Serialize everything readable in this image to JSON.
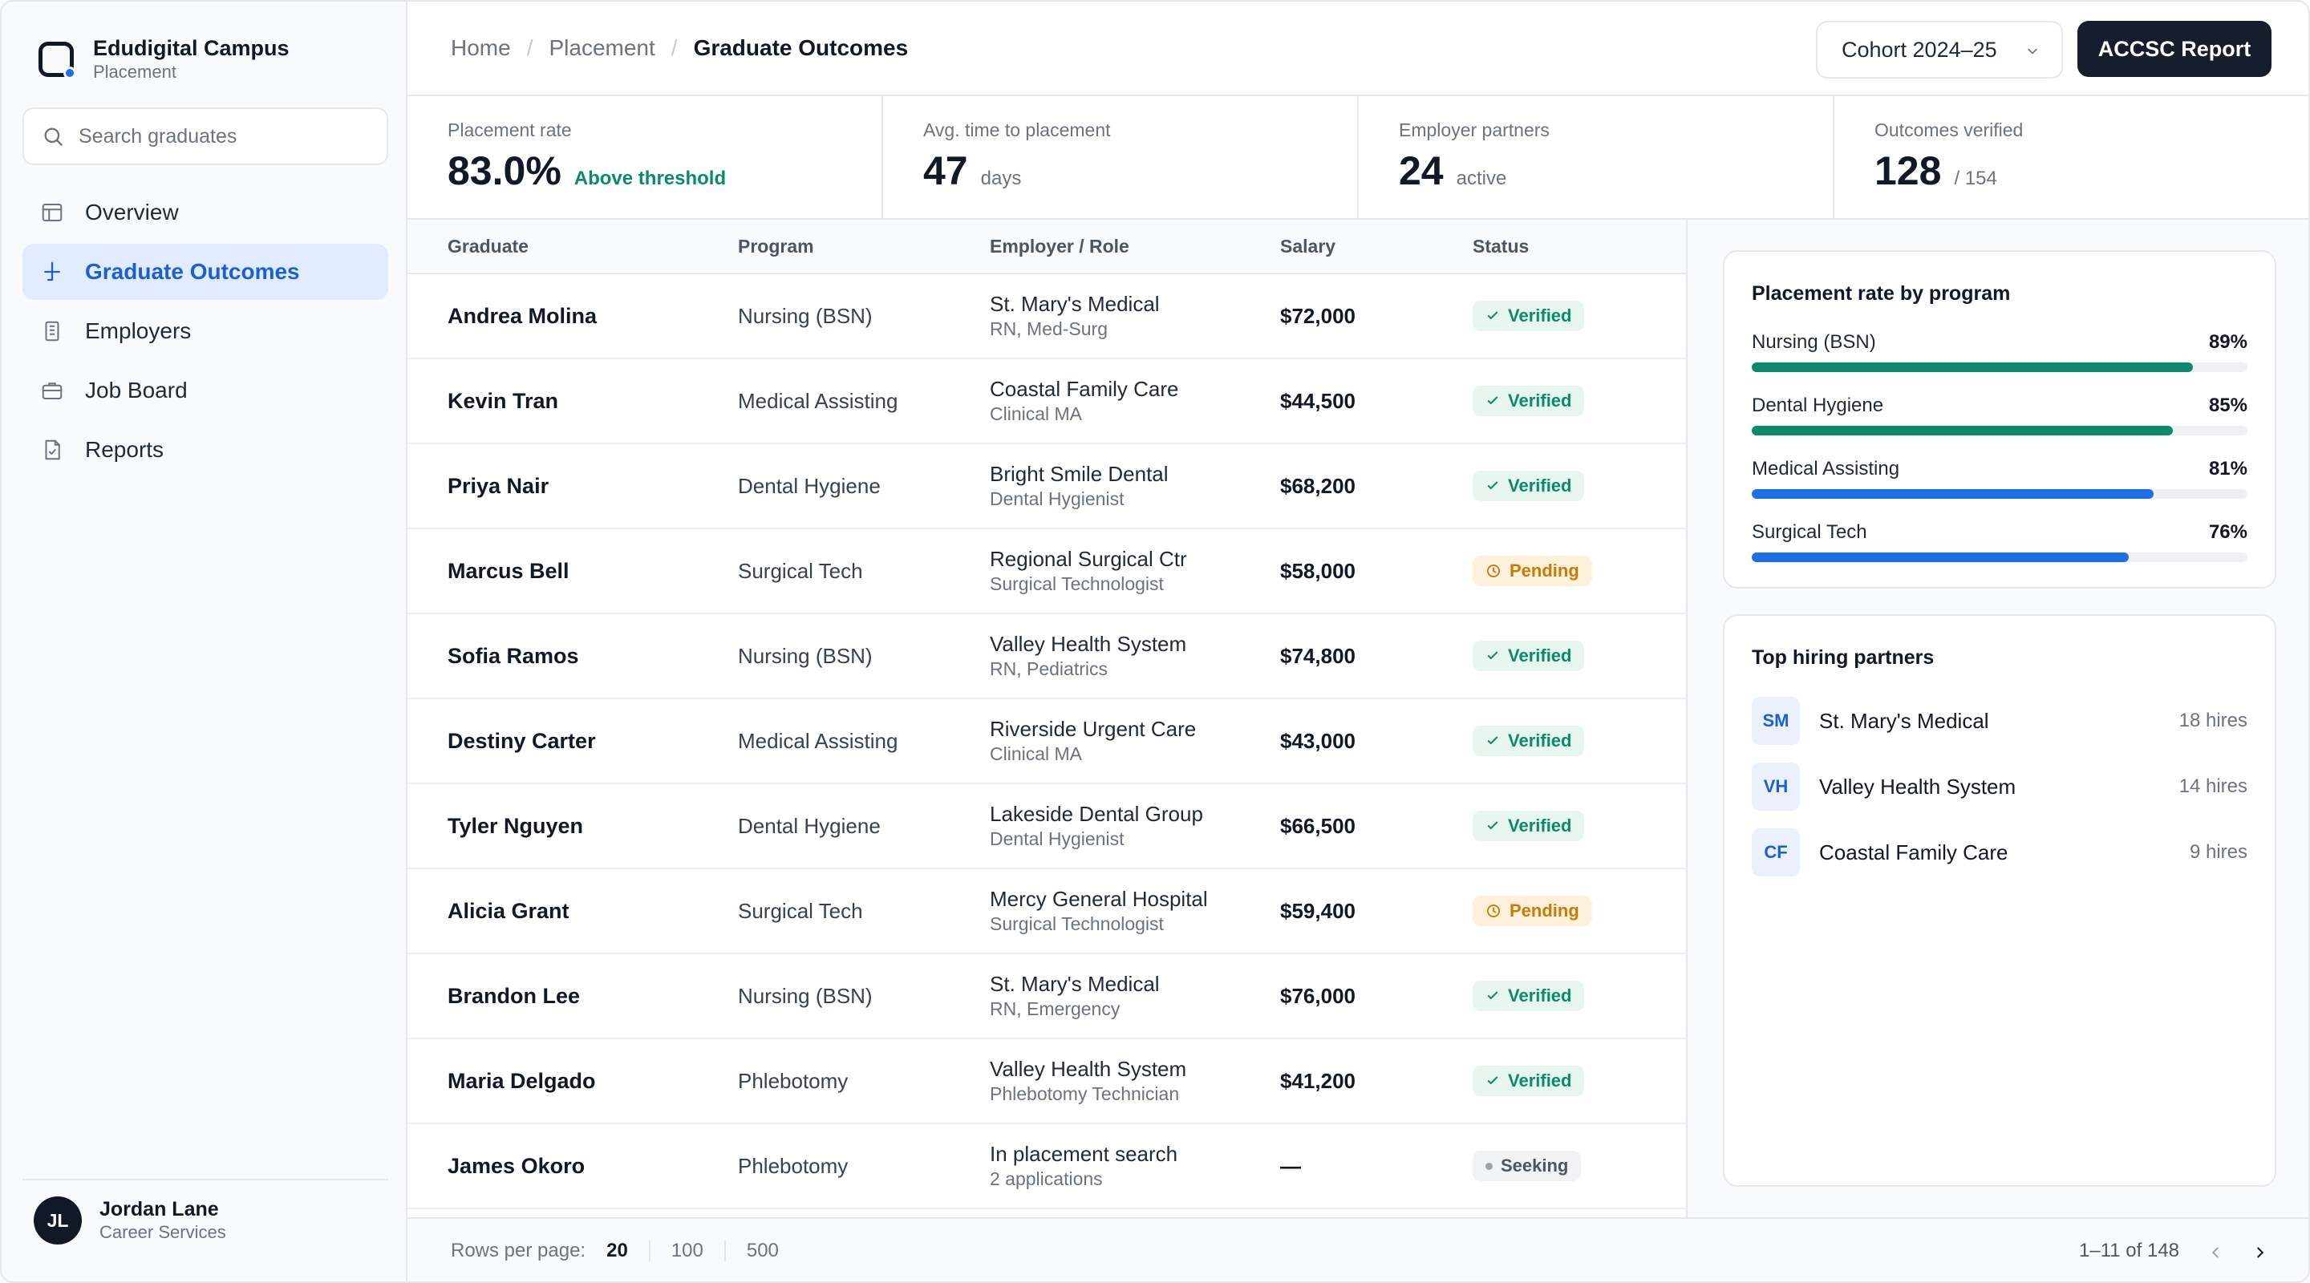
{
  "brand": {
    "name": "Edudigital Campus",
    "sub": "Placement"
  },
  "search": {
    "placeholder": "Search graduates"
  },
  "nav": [
    {
      "label": "Overview",
      "icon": "layout-icon"
    },
    {
      "label": "Graduate Outcomes",
      "icon": "outcomes-icon",
      "active": true
    },
    {
      "label": "Employers",
      "icon": "building-icon"
    },
    {
      "label": "Job Board",
      "icon": "briefcase-icon"
    },
    {
      "label": "Reports",
      "icon": "file-check-icon"
    }
  ],
  "user": {
    "initials": "JL",
    "name": "Jordan Lane",
    "role": "Career Services"
  },
  "breadcrumb": [
    "Home",
    "Placement",
    "Graduate Outcomes"
  ],
  "cohort": "Cohort 2024–25",
  "report_button": "ACCSC Report",
  "stats": [
    {
      "label": "Placement rate",
      "value": "83.0%",
      "suffix": "Above threshold",
      "good": true
    },
    {
      "label": "Avg. time to placement",
      "value": "47",
      "suffix": "days"
    },
    {
      "label": "Employer partners",
      "value": "24",
      "suffix": "active"
    },
    {
      "label": "Outcomes verified",
      "value": "128",
      "suffix": "/ 154"
    }
  ],
  "table": {
    "headers": [
      "Graduate",
      "Program",
      "Employer / Role",
      "Salary",
      "Status"
    ],
    "rows": [
      {
        "name": "Andrea Molina",
        "program": "Nursing (BSN)",
        "employer": "St. Mary's Medical",
        "role": "RN, Med-Surg",
        "salary": "$72,000",
        "status": "Verified"
      },
      {
        "name": "Kevin Tran",
        "program": "Medical Assisting",
        "employer": "Coastal Family Care",
        "role": "Clinical MA",
        "salary": "$44,500",
        "status": "Verified"
      },
      {
        "name": "Priya Nair",
        "program": "Dental Hygiene",
        "employer": "Bright Smile Dental",
        "role": "Dental Hygienist",
        "salary": "$68,200",
        "status": "Verified"
      },
      {
        "name": "Marcus Bell",
        "program": "Surgical Tech",
        "employer": "Regional Surgical Ctr",
        "role": "Surgical Technologist",
        "salary": "$58,000",
        "status": "Pending"
      },
      {
        "name": "Sofia Ramos",
        "program": "Nursing (BSN)",
        "employer": "Valley Health System",
        "role": "RN, Pediatrics",
        "salary": "$74,800",
        "status": "Verified"
      },
      {
        "name": "Destiny Carter",
        "program": "Medical Assisting",
        "employer": "Riverside Urgent Care",
        "role": "Clinical MA",
        "salary": "$43,000",
        "status": "Verified"
      },
      {
        "name": "Tyler Nguyen",
        "program": "Dental Hygiene",
        "employer": "Lakeside Dental Group",
        "role": "Dental Hygienist",
        "salary": "$66,500",
        "status": "Verified"
      },
      {
        "name": "Alicia Grant",
        "program": "Surgical Tech",
        "employer": "Mercy General Hospital",
        "role": "Surgical Technologist",
        "salary": "$59,400",
        "status": "Pending"
      },
      {
        "name": "Brandon Lee",
        "program": "Nursing (BSN)",
        "employer": "St. Mary's Medical",
        "role": "RN, Emergency",
        "salary": "$76,000",
        "status": "Verified"
      },
      {
        "name": "Maria Delgado",
        "program": "Phlebotomy",
        "employer": "Valley Health System",
        "role": "Phlebotomy Technician",
        "salary": "$41,200",
        "status": "Verified"
      },
      {
        "name": "James Okoro",
        "program": "Phlebotomy",
        "employer": "In placement search",
        "role": "2 applications",
        "salary": "—",
        "status": "Seeking"
      }
    ]
  },
  "footer": {
    "rows_label": "Rows per page:",
    "rows_options": [
      "20",
      "100",
      "500"
    ],
    "rows_selected": "20",
    "range": "1–11 of 148"
  },
  "placement_by_program": {
    "title": "Placement rate by program",
    "items": [
      {
        "label": "Nursing (BSN)",
        "pct": "89%",
        "value": 89,
        "color": "#0d8a6e"
      },
      {
        "label": "Dental Hygiene",
        "pct": "85%",
        "value": 85,
        "color": "#0d8a6e"
      },
      {
        "label": "Medical Assisting",
        "pct": "81%",
        "value": 81,
        "color": "#1d6fe8"
      },
      {
        "label": "Surgical Tech",
        "pct": "76%",
        "value": 76,
        "color": "#1d6fe8"
      }
    ]
  },
  "top_partners": {
    "title": "Top hiring partners",
    "items": [
      {
        "initials": "SM",
        "name": "St. Mary's Medical",
        "hires": "18 hires"
      },
      {
        "initials": "VH",
        "name": "Valley Health System",
        "hires": "14 hires"
      },
      {
        "initials": "CF",
        "name": "Coastal Family Care",
        "hires": "9 hires"
      }
    ]
  }
}
